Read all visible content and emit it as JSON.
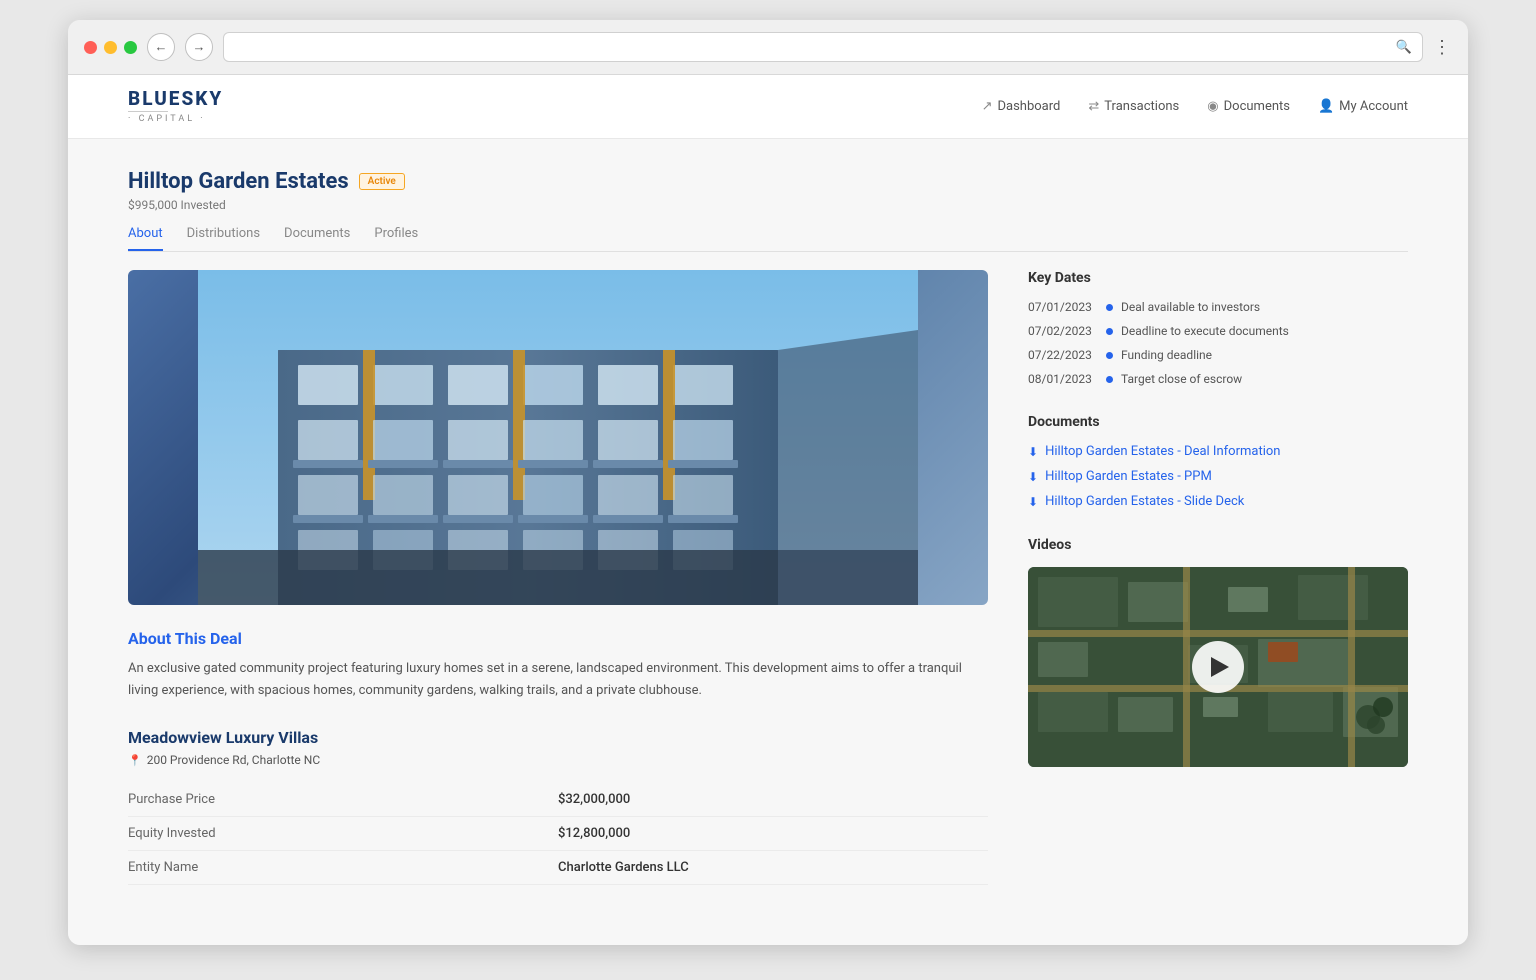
{
  "browser": {
    "back_label": "←",
    "forward_label": "→",
    "search_placeholder": "",
    "menu_label": "⋮"
  },
  "nav": {
    "logo_bluesky": "BLUESKY",
    "logo_capital": "· CAPITAL ·",
    "links": [
      {
        "id": "dashboard",
        "icon": "↗",
        "label": "Dashboard"
      },
      {
        "id": "transactions",
        "icon": "⇄",
        "label": "Transactions"
      },
      {
        "id": "documents",
        "icon": "◉",
        "label": "Documents"
      },
      {
        "id": "my-account",
        "icon": "👤",
        "label": "My Account"
      }
    ]
  },
  "property": {
    "title": "Hilltop Garden Estates",
    "status_badge": "Active",
    "invested_label": "$995,000 Invested",
    "tabs": [
      {
        "id": "about",
        "label": "About",
        "active": true
      },
      {
        "id": "distributions",
        "label": "Distributions",
        "active": false
      },
      {
        "id": "documents",
        "label": "Documents",
        "active": false
      },
      {
        "id": "profiles",
        "label": "Profiles",
        "active": false
      }
    ]
  },
  "about": {
    "section_title": "About This Deal",
    "description": "An exclusive gated community project featuring luxury homes set in a serene, landscaped environment. This development aims to offer a tranquil living experience, with spacious homes, community gardens, walking trails, and a private clubhouse."
  },
  "detail_property": {
    "title": "Meadowview Luxury Villas",
    "address": "200 Providence Rd, Charlotte NC",
    "rows": [
      {
        "label": "Purchase Price",
        "value": "$32,000,000"
      },
      {
        "label": "Equity Invested",
        "value": "$12,800,000"
      },
      {
        "label": "Entity Name",
        "value": "Charlotte Gardens LLC"
      }
    ]
  },
  "sidebar": {
    "key_dates_title": "Key Dates",
    "key_dates": [
      {
        "date": "07/01/2023",
        "label": "Deal available to investors"
      },
      {
        "date": "07/02/2023",
        "label": "Deadline to execute documents"
      },
      {
        "date": "07/22/2023",
        "label": "Funding deadline"
      },
      {
        "date": "08/01/2023",
        "label": "Target close of escrow"
      }
    ],
    "documents_title": "Documents",
    "documents": [
      {
        "label": "Hilltop Garden Estates - Deal Information"
      },
      {
        "label": "Hilltop Garden Estates - PPM"
      },
      {
        "label": "Hilltop Garden Estates - Slide Deck"
      }
    ],
    "videos_title": "Videos"
  }
}
